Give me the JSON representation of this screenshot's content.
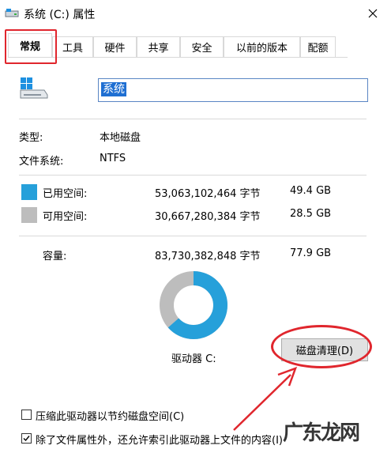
{
  "window": {
    "title": "系统 (C:) 属性",
    "close_label": "×"
  },
  "tabs": [
    {
      "label": "常规",
      "active": true
    },
    {
      "label": "工具"
    },
    {
      "label": "硬件"
    },
    {
      "label": "共享"
    },
    {
      "label": "安全"
    },
    {
      "label": "以前的版本"
    },
    {
      "label": "配额"
    }
  ],
  "drive": {
    "name": "系统"
  },
  "info": {
    "type_label": "类型:",
    "type_value": "本地磁盘",
    "fs_label": "文件系统:",
    "fs_value": "NTFS"
  },
  "usage": {
    "used_label": "已用空间:",
    "used_bytes": "53,063,102,464 字节",
    "used_gb": "49.4 GB",
    "used_color": "#26a0da",
    "free_label": "可用空间:",
    "free_bytes": "30,667,280,384 字节",
    "free_gb": "28.5 GB",
    "free_color": "#bdbdbd",
    "capacity_label": "容量:",
    "capacity_bytes": "83,730,382,848 字节",
    "capacity_gb": "77.9 GB",
    "used_fraction": 0.634
  },
  "drive_label": "驱动器 C:",
  "cleanup_button": "磁盘清理(D)",
  "options": {
    "compress": "压缩此驱动器以节约磁盘空间(C)",
    "compress_checked": false,
    "index": "除了文件属性外，还允许索引此驱动器上文件的内容(I)",
    "index_checked": true
  },
  "watermark": "广东龙网"
}
